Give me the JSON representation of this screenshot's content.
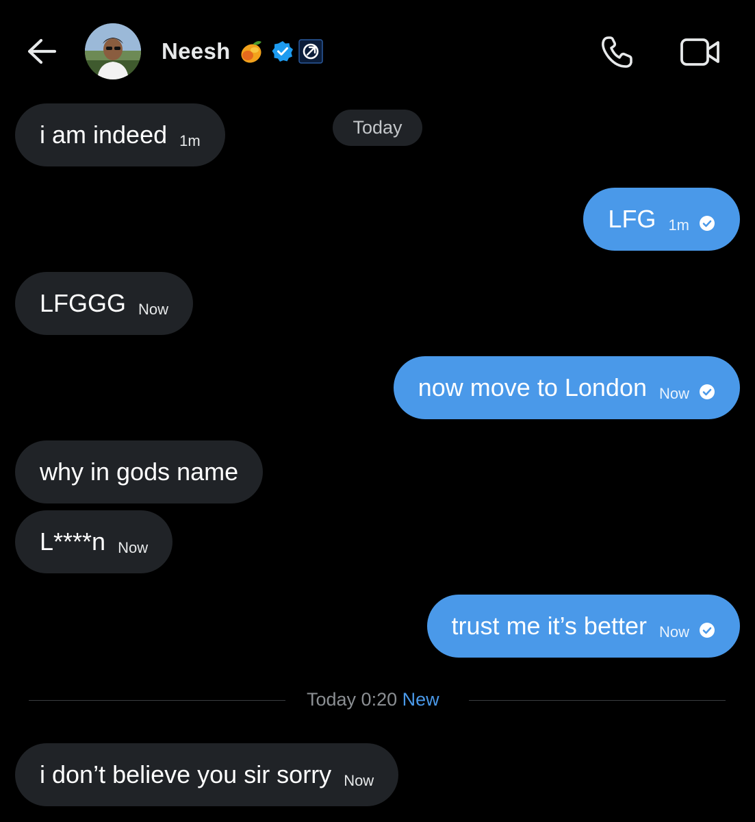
{
  "header": {
    "contact_name": "Neesh",
    "name_emoji": "mango-icon",
    "badges": [
      "verified-icon",
      "affiliate-icon"
    ],
    "actions": [
      "phone-icon",
      "video-call-icon"
    ]
  },
  "colors": {
    "background": "#000000",
    "incoming_bubble": "#202327",
    "outgoing_bubble": "#4a99e9",
    "accent": "#4a99e9"
  },
  "date_pill": "Today",
  "messages": [
    {
      "side": "in",
      "text": "i am indeed",
      "time": "1m"
    },
    {
      "side": "out",
      "text": "LFG",
      "time": "1m",
      "read": true
    },
    {
      "side": "in",
      "text": "LFGGG",
      "time": "Now"
    },
    {
      "side": "out",
      "text": "now move to London",
      "time": "Now",
      "read": true
    },
    {
      "side": "in",
      "text": "why in gods name",
      "time": ""
    },
    {
      "side": "in",
      "text": "L****n",
      "time": "Now"
    },
    {
      "side": "out",
      "text": "trust me it’s better",
      "time": "Now",
      "read": true
    },
    {
      "side": "in",
      "text": "i don’t believe you sir sorry",
      "time": "Now"
    }
  ],
  "divider": {
    "label": "Today 0:20",
    "new_label": "New"
  }
}
